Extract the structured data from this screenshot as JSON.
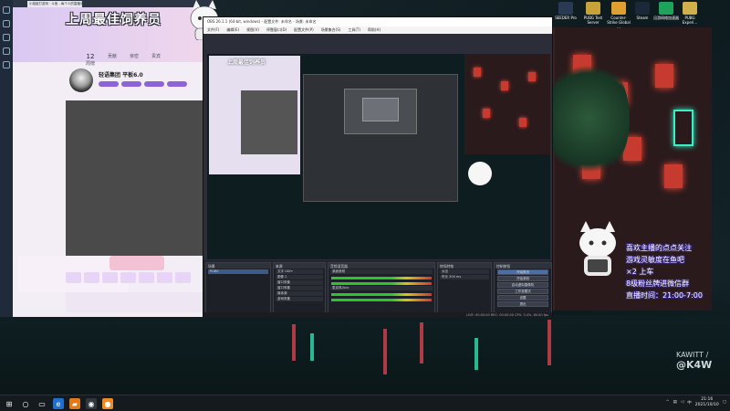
{
  "desktop": {
    "watermark_line1": "KAWITT /",
    "watermark_line2": "@K4W",
    "icons": [
      {
        "label": "SEEDER Pro",
        "color": "#2a3a52"
      },
      {
        "label": "PUBG Test Server",
        "color": "#c7a23b"
      },
      {
        "label": "Counter-Strike Global ...",
        "color": "#e0a030"
      },
      {
        "label": "Steam",
        "color": "#1b2838"
      },
      {
        "label": "迅游网络加速器",
        "color": "#1ea45a"
      },
      {
        "label": "PUBG Experi...",
        "color": "#d0b04a"
      }
    ]
  },
  "browser": {
    "tab_title": "小姐姐打游戏 · 斗鱼 - 每个人的直播平台",
    "banner_title": "上周最佳饲养员",
    "stats": [
      {
        "value": "12",
        "label": "周榜"
      },
      {
        "value": "",
        "label": "贡献"
      },
      {
        "value": "",
        "label": "亲密"
      },
      {
        "value": "",
        "label": "贵宾"
      }
    ],
    "streamer_name": "轻语集团 平板6.0"
  },
  "obs": {
    "title": "OBS 26.1.1 (64-bit, windows) - 配置文件: 未命名 - 场景: 未命名",
    "menu": [
      "文件(F)",
      "编辑(E)",
      "视图(V)",
      "停靠窗口(D)",
      "配置文件(P)",
      "场景集合(S)",
      "工具(T)",
      "帮助(H)"
    ],
    "preview_mini_title": "上周最佳饲养员",
    "docks": {
      "scenes_title": "场景",
      "scenes": [
        "PUBG"
      ],
      "sources_title": "来源",
      "sources": [
        "文字 GDI+",
        "图像 2",
        "窗口采集",
        "窗口采集",
        "媒体源",
        "游戏采集"
      ],
      "mixer_title": "音频混音器",
      "mixer": [
        "桌面音频",
        "麦克风/Aux"
      ],
      "trans_title": "转场特效",
      "trans": [
        "淡出",
        "时长 300 ms"
      ],
      "controls_title": "控制按钮",
      "controls": [
        "开始推流",
        "开始录制",
        "启动虚拟摄像机",
        "工作室模式",
        "设置",
        "退出"
      ]
    },
    "status": "LIVE: 00:00:00  REC: 00:00:00  CPU: 3.4%, 60.00 fps"
  },
  "overlay": {
    "line1": "喜欢主播的点点关注",
    "line2": "游戏灵敏度在鱼吧",
    "line3": "×2 上车",
    "line4": "8级粉丝牌进微信群",
    "line5": "直播时间：21:00-7:00"
  },
  "taskbar": {
    "time": "21:16",
    "date": "2021/10/10",
    "lang": "中"
  }
}
